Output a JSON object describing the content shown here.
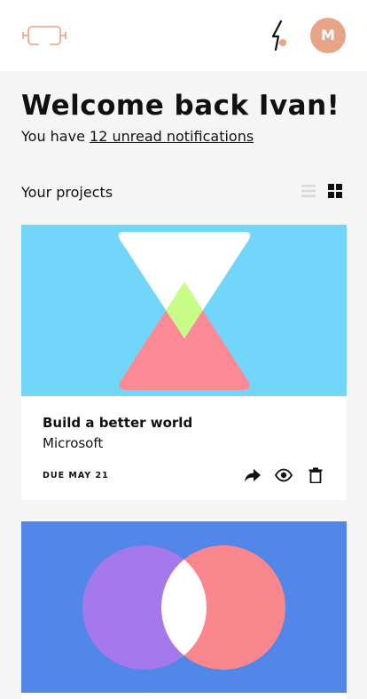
{
  "user": {
    "avatar_initial": "M"
  },
  "welcome": {
    "title": "Welcome back Ivan!",
    "prefix": "You have ",
    "link": "12 unread notifications"
  },
  "projects": {
    "title": "Your projects",
    "items": [
      {
        "title": "Build a better world",
        "client": "Microsoft",
        "due": "DUE MAY 21"
      },
      {
        "title": "",
        "client": "",
        "due": ""
      }
    ]
  },
  "icons": [
    "logo-icon",
    "lightning-bolt-icon",
    "list-view-icon",
    "grid-view-icon",
    "share-icon",
    "eye-icon",
    "trash-icon"
  ],
  "colors": {
    "accent": "#e8a486",
    "card1_bg": "#72d5fa",
    "card1_pink": "#fb8a94",
    "card1_lime": "#c7fc86",
    "card2_bg": "#5286e8",
    "card2_purple": "#a579ec",
    "card2_pink": "#fa878e"
  }
}
